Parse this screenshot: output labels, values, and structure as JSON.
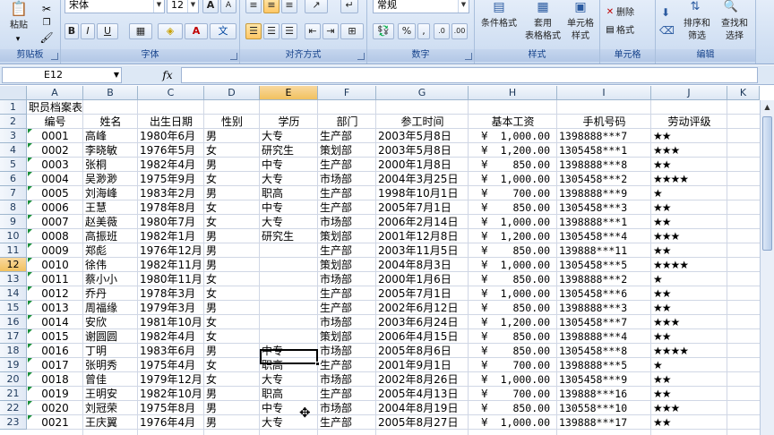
{
  "ribbon": {
    "clipboard": {
      "label": "剪贴板",
      "paste": "粘贴"
    },
    "font": {
      "label": "字体",
      "name": "宋体",
      "size": "12",
      "bold": "B",
      "italic": "I",
      "underline": "U",
      "phonetic": "文"
    },
    "alignment": {
      "label": "对齐方式"
    },
    "number": {
      "label": "数字",
      "format": "常规"
    },
    "styles": {
      "label": "样式",
      "conditional": "条件格式",
      "table_line1": "套用",
      "table_line2": "表格格式",
      "cell_line1": "单元格",
      "cell_line2": "样式"
    },
    "cells": {
      "label": "单元格",
      "delete": "删除",
      "format": "格式"
    },
    "editing": {
      "label": "编辑",
      "sort_line1": "排序和",
      "sort_line2": "筛选",
      "find_line1": "查找和",
      "find_line2": "选择"
    }
  },
  "formula_bar": {
    "name_box": "E12",
    "fx": "fx",
    "content": ""
  },
  "columns": [
    "A",
    "B",
    "C",
    "D",
    "E",
    "F",
    "G",
    "H",
    "I",
    "J",
    "K"
  ],
  "selected_column": "E",
  "selected_row": "12",
  "title_row": {
    "row": "1",
    "text": "职员档案表"
  },
  "header_row": {
    "row": "2",
    "cells": [
      "编号",
      "姓名",
      "出生日期",
      "性别",
      "学历",
      "部门",
      "参工时间",
      "基本工资",
      "手机号码",
      "劳动评级"
    ]
  },
  "rows": [
    {
      "row": "3",
      "id": "0001",
      "name": "高峰",
      "birth": "1980年6月",
      "sex": "男",
      "edu": "大专",
      "dept": "生产部",
      "start": "2003年5月8日",
      "cur": "¥",
      "salary": "1,000.00",
      "phone": "1398888***7",
      "stars": "★★"
    },
    {
      "row": "4",
      "id": "0002",
      "name": "李晓敏",
      "birth": "1976年5月",
      "sex": "女",
      "edu": "研究生",
      "dept": "策划部",
      "start": "2003年5月8日",
      "cur": "¥",
      "salary": "1,200.00",
      "phone": "1305458***1",
      "stars": "★★★"
    },
    {
      "row": "5",
      "id": "0003",
      "name": "张桐",
      "birth": "1982年4月",
      "sex": "男",
      "edu": "中专",
      "dept": "生产部",
      "start": "2000年1月8日",
      "cur": "¥",
      "salary": "850.00",
      "phone": "1398888***8",
      "stars": "★★"
    },
    {
      "row": "6",
      "id": "0004",
      "name": "吴渺渺",
      "birth": "1975年9月",
      "sex": "女",
      "edu": "大专",
      "dept": "市场部",
      "start": "2004年3月25日",
      "cur": "¥",
      "salary": "1,000.00",
      "phone": "1305458***2",
      "stars": "★★★★"
    },
    {
      "row": "7",
      "id": "0005",
      "name": "刘海峰",
      "birth": "1983年2月",
      "sex": "男",
      "edu": "职高",
      "dept": "生产部",
      "start": "1998年10月1日",
      "cur": "¥",
      "salary": "700.00",
      "phone": "1398888***9",
      "stars": "★"
    },
    {
      "row": "8",
      "id": "0006",
      "name": "王慧",
      "birth": "1978年8月",
      "sex": "女",
      "edu": "中专",
      "dept": "生产部",
      "start": "2005年7月1日",
      "cur": "¥",
      "salary": "850.00",
      "phone": "1305458***3",
      "stars": "★★"
    },
    {
      "row": "9",
      "id": "0007",
      "name": "赵美薇",
      "birth": "1980年7月",
      "sex": "女",
      "edu": "大专",
      "dept": "市场部",
      "start": "2006年2月14日",
      "cur": "¥",
      "salary": "1,000.00",
      "phone": "1398888***1",
      "stars": "★★"
    },
    {
      "row": "10",
      "id": "0008",
      "name": "高振班",
      "birth": "1982年1月",
      "sex": "男",
      "edu": "研究生",
      "dept": "策划部",
      "start": "2001年12月8日",
      "cur": "¥",
      "salary": "1,200.00",
      "phone": "1305458***4",
      "stars": "★★★"
    },
    {
      "row": "11",
      "id": "0009",
      "name": "郑彪",
      "birth": "1976年12月",
      "sex": "男",
      "edu": "",
      "dept": "生产部",
      "start": "2003年11月5日",
      "cur": "¥",
      "salary": "850.00",
      "phone": "139888***11",
      "stars": "★★"
    },
    {
      "row": "12",
      "id": "0010",
      "name": "徐伟",
      "birth": "1982年11月",
      "sex": "男",
      "edu": "",
      "dept": "策划部",
      "start": "2004年8月3日",
      "cur": "¥",
      "salary": "1,000.00",
      "phone": "1305458***5",
      "stars": "★★★★"
    },
    {
      "row": "13",
      "id": "0011",
      "name": "蔡小小",
      "birth": "1980年11月",
      "sex": "女",
      "edu": "",
      "dept": "市场部",
      "start": "2000年1月6日",
      "cur": "¥",
      "salary": "850.00",
      "phone": "1398888***2",
      "stars": "★"
    },
    {
      "row": "14",
      "id": "0012",
      "name": "乔丹",
      "birth": "1978年3月",
      "sex": "女",
      "edu": "",
      "dept": "生产部",
      "start": "2005年7月1日",
      "cur": "¥",
      "salary": "1,000.00",
      "phone": "1305458***6",
      "stars": "★★"
    },
    {
      "row": "15",
      "id": "0013",
      "name": "周福缘",
      "birth": "1979年3月",
      "sex": "男",
      "edu": "",
      "dept": "生产部",
      "start": "2002年6月12日",
      "cur": "¥",
      "salary": "850.00",
      "phone": "1398888***3",
      "stars": "★★"
    },
    {
      "row": "16",
      "id": "0014",
      "name": "安欣",
      "birth": "1981年10月",
      "sex": "女",
      "edu": "",
      "dept": "市场部",
      "start": "2003年6月24日",
      "cur": "¥",
      "salary": "1,200.00",
      "phone": "1305458***7",
      "stars": "★★★"
    },
    {
      "row": "17",
      "id": "0015",
      "name": "谢圆圆",
      "birth": "1982年4月",
      "sex": "女",
      "edu": "",
      "dept": "策划部",
      "start": "2006年4月15日",
      "cur": "¥",
      "salary": "850.00",
      "phone": "1398888***4",
      "stars": "★★"
    },
    {
      "row": "18",
      "id": "0016",
      "name": "丁明",
      "birth": "1983年6月",
      "sex": "男",
      "edu": "中专",
      "dept": "市场部",
      "start": "2005年8月6日",
      "cur": "¥",
      "salary": "850.00",
      "phone": "1305458***8",
      "stars": "★★★★"
    },
    {
      "row": "19",
      "id": "0017",
      "name": "张明秀",
      "birth": "1975年4月",
      "sex": "女",
      "edu": "职高",
      "dept": "生产部",
      "start": "2001年9月1日",
      "cur": "¥",
      "salary": "700.00",
      "phone": "1398888***5",
      "stars": "★"
    },
    {
      "row": "20",
      "id": "0018",
      "name": "曾佳",
      "birth": "1979年12月",
      "sex": "女",
      "edu": "大专",
      "dept": "市场部",
      "start": "2002年8月26日",
      "cur": "¥",
      "salary": "1,000.00",
      "phone": "1305458***9",
      "stars": "★★"
    },
    {
      "row": "21",
      "id": "0019",
      "name": "王明安",
      "birth": "1982年10月",
      "sex": "男",
      "edu": "职高",
      "dept": "生产部",
      "start": "2005年4月13日",
      "cur": "¥",
      "salary": "700.00",
      "phone": "139888***16",
      "stars": "★★"
    },
    {
      "row": "22",
      "id": "0020",
      "name": "刘冠荣",
      "birth": "1975年8月",
      "sex": "男",
      "edu": "中专",
      "dept": "市场部",
      "start": "2004年8月19日",
      "cur": "¥",
      "salary": "850.00",
      "phone": "130558***10",
      "stars": "★★★"
    },
    {
      "row": "23",
      "id": "0021",
      "name": "王庆翼",
      "birth": "1976年4月",
      "sex": "男",
      "edu": "大专",
      "dept": "生产部",
      "start": "2005年8月27日",
      "cur": "¥",
      "salary": "1,000.00",
      "phone": "139888***17",
      "stars": "★★"
    }
  ]
}
